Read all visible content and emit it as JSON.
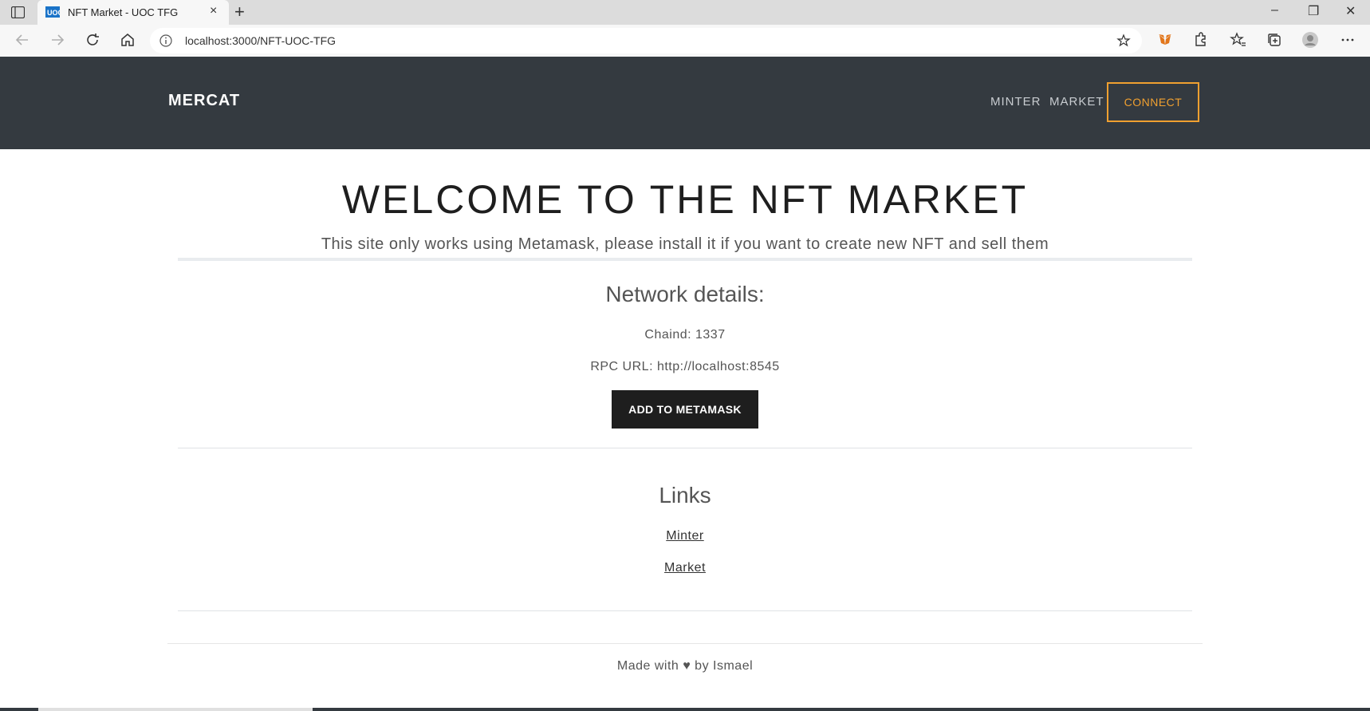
{
  "browser": {
    "tab_title": "NFT Market - UOC TFG",
    "url": "localhost:3000/NFT-UOC-TFG",
    "new_tab": "+",
    "close_tab": "×",
    "window_controls": [
      "–",
      "❐",
      "✕"
    ]
  },
  "header": {
    "brand": "MERCAT",
    "nav": [
      "MINTER",
      "MARKET"
    ],
    "connect_label": "CONNECT",
    "accent_color": "#f0a030",
    "background": "#343a40"
  },
  "hero": {
    "title": "WELCOME TO THE NFT MARKET",
    "subtitle": "This site only works using Metamask, please install it if you want to create new NFT and sell them"
  },
  "network": {
    "heading": "Network details:",
    "chain_id": "Chaind: 1337",
    "rpc_url": "RPC URL: http://localhost:8545",
    "button_label": "ADD TO METAMASK"
  },
  "links": {
    "heading": "Links",
    "items": [
      "Minter",
      "Market"
    ]
  },
  "footer": {
    "text": "Made with ♥ by Ismael"
  }
}
